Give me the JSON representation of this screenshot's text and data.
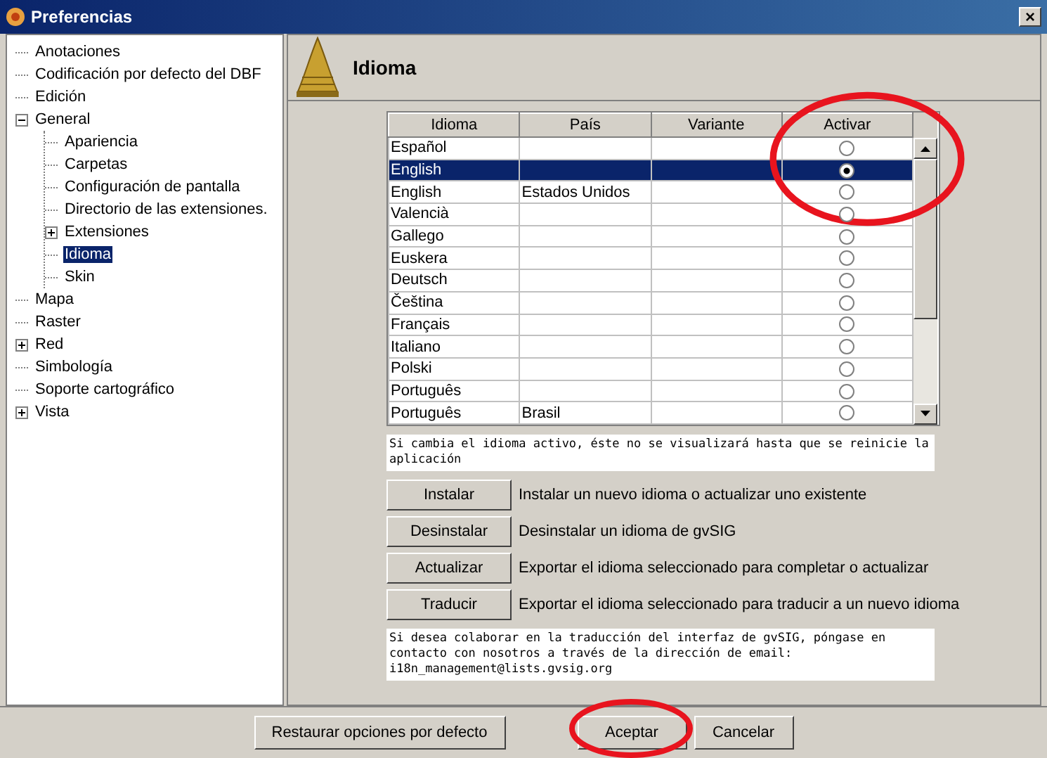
{
  "window": {
    "title": "Preferencias",
    "close": "×"
  },
  "tree": [
    {
      "label": "Anotaciones",
      "selected": false
    },
    {
      "label": "Codificación por defecto del DBF",
      "selected": false
    },
    {
      "label": "Edición",
      "selected": false
    },
    {
      "label": "General",
      "selected": false,
      "expanded": true,
      "children": [
        {
          "label": "Apariencia",
          "selected": false
        },
        {
          "label": "Carpetas",
          "selected": false
        },
        {
          "label": "Configuración de pantalla",
          "selected": false
        },
        {
          "label": "Directorio de las extensiones.",
          "selected": false
        },
        {
          "label": "Extensiones",
          "selected": false,
          "expanded": false
        },
        {
          "label": "Idioma",
          "selected": true
        },
        {
          "label": "Skin",
          "selected": false
        }
      ]
    },
    {
      "label": "Mapa",
      "selected": false
    },
    {
      "label": "Raster",
      "selected": false
    },
    {
      "label": "Red",
      "selected": false,
      "expanded": false
    },
    {
      "label": "Simbología",
      "selected": false
    },
    {
      "label": "Soporte cartográfico",
      "selected": false
    },
    {
      "label": "Vista",
      "selected": false,
      "expanded": false
    }
  ],
  "panel": {
    "title": "Idioma"
  },
  "table": {
    "columns": [
      "Idioma",
      "País",
      "Variante",
      "Activar"
    ],
    "rows": [
      {
        "idioma": "Español",
        "selected": false,
        "active": false
      },
      {
        "idioma": "English",
        "selected": true,
        "active": true
      },
      {
        "idioma": "English",
        "pais": "Estados Unidos",
        "selected": false,
        "active": false
      },
      {
        "idioma": "Valencià",
        "selected": false,
        "active": false
      },
      {
        "idioma": "Gallego",
        "selected": false,
        "active": false
      },
      {
        "idioma": "Euskera",
        "selected": false,
        "active": false
      },
      {
        "idioma": "Deutsch",
        "selected": false,
        "active": false
      },
      {
        "idioma": "Čeština",
        "selected": false,
        "active": false
      },
      {
        "idioma": "Français",
        "selected": false,
        "active": false
      },
      {
        "idioma": "Italiano",
        "selected": false,
        "active": false
      },
      {
        "idioma": "Polski",
        "selected": false,
        "active": false
      },
      {
        "idioma": "Português",
        "selected": false,
        "active": false
      },
      {
        "idioma": "Português",
        "pais": "Brasil",
        "selected": false,
        "active": false
      }
    ]
  },
  "restart_note": "Si cambia el idioma activo, éste no se visualizará hasta que se reinicie la aplicación",
  "actions": [
    {
      "button": "Instalar",
      "description": "Instalar un nuevo idioma o actualizar uno existente"
    },
    {
      "button": "Desinstalar",
      "description": "Desinstalar un idioma de gvSIG"
    },
    {
      "button": "Actualizar",
      "description": "Exportar el idioma seleccionado para completar o actualizar"
    },
    {
      "button": "Traducir",
      "description": "Exportar el idioma seleccionado para traducir a un nuevo idioma"
    }
  ],
  "contact_note": "Si desea colaborar en la traducción del interfaz de gvSIG, póngase en contacto con nosotros a través de la dirección de email: i18n_management@lists.gvsig.org",
  "footer_buttons": [
    "Restaurar opciones por defecto",
    "Aceptar",
    "Cancelar"
  ]
}
